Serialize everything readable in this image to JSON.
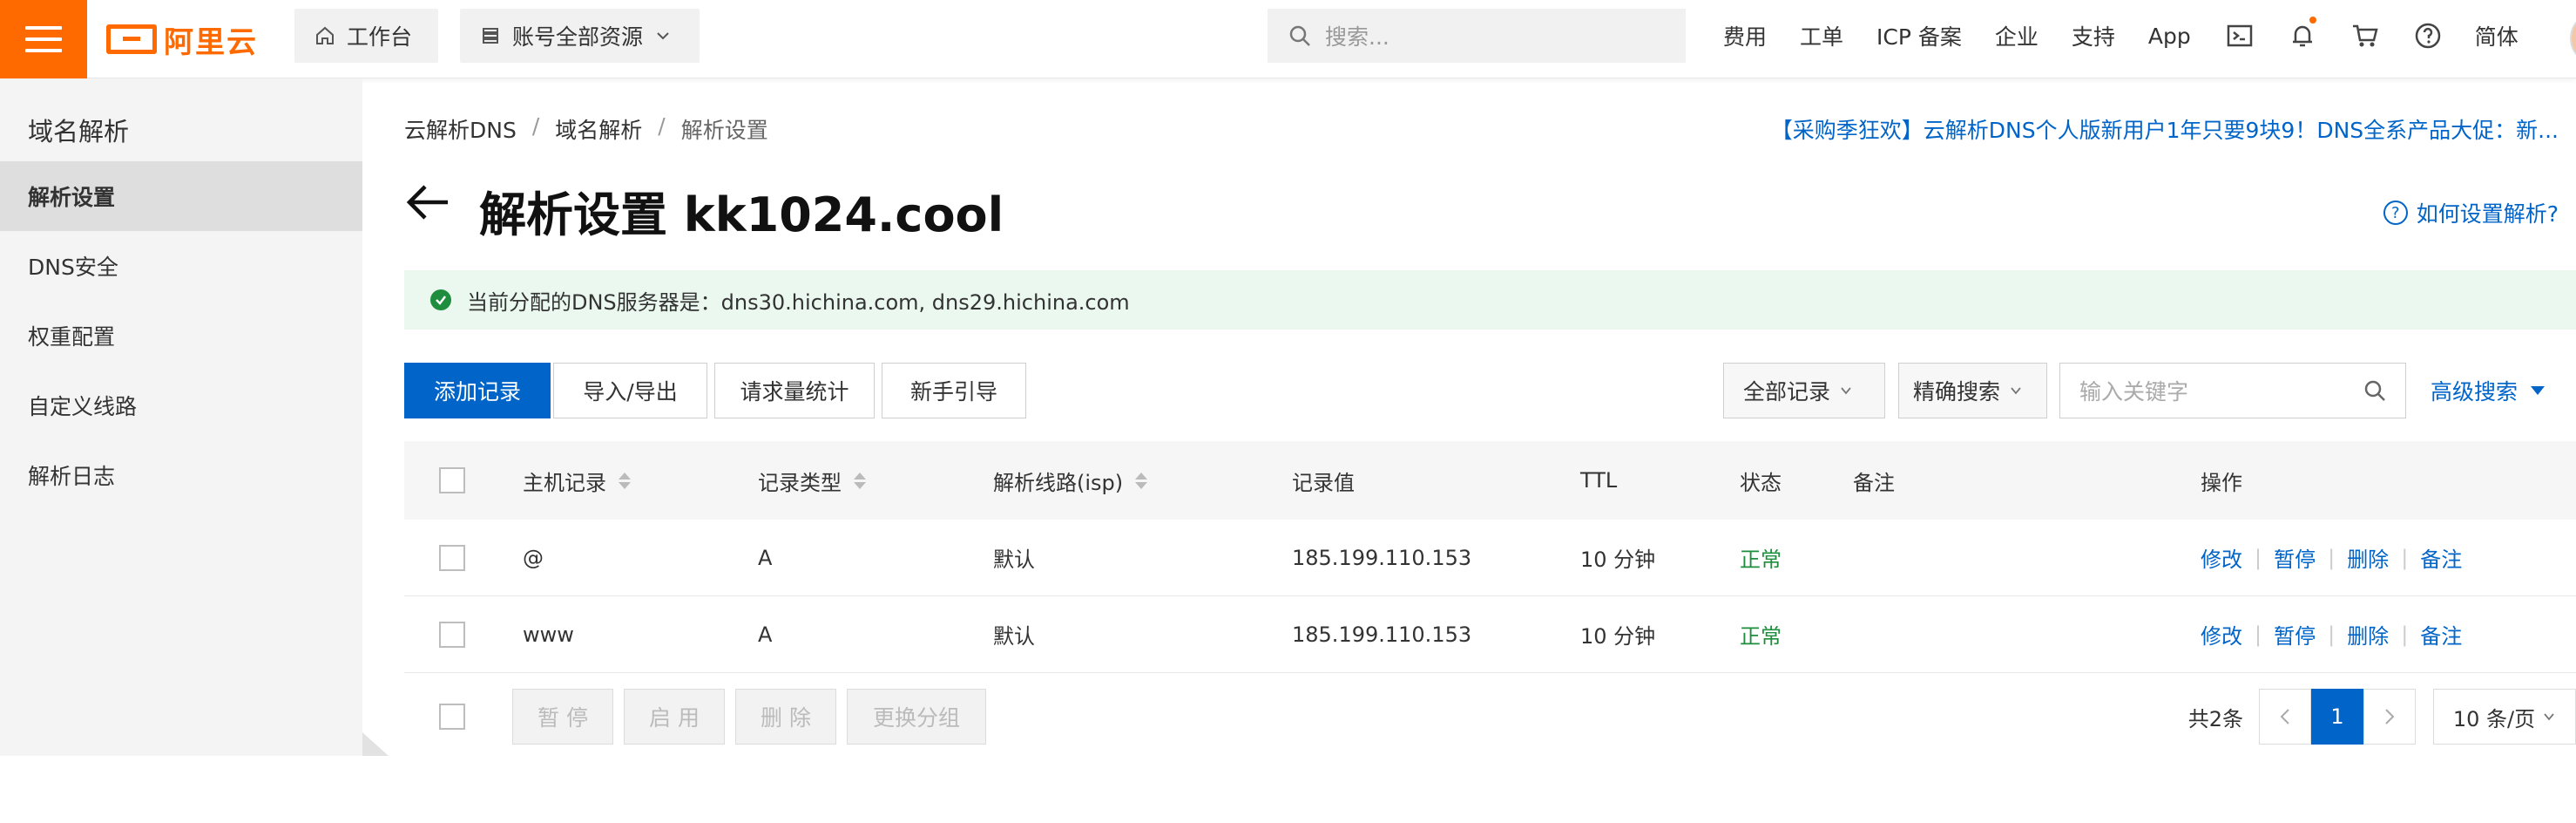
{
  "topbar": {
    "logo_text": "阿里云",
    "workbench": "工作台",
    "resources": "账号全部资源",
    "search_placeholder": "搜索...",
    "links": [
      "费用",
      "工单",
      "ICP 备案",
      "企业",
      "支持",
      "App"
    ],
    "language": "简体",
    "icons": [
      "terminal-icon",
      "bell-icon",
      "cart-icon",
      "help-icon"
    ],
    "accent": "#ff6a00"
  },
  "sidebar": {
    "title": "域名解析",
    "items": [
      {
        "label": "解析设置",
        "active": true
      },
      {
        "label": "DNS安全",
        "active": false
      },
      {
        "label": "权重配置",
        "active": false
      },
      {
        "label": "自定义线路",
        "active": false
      },
      {
        "label": "解析日志",
        "active": false
      }
    ]
  },
  "breadcrumb": [
    "云解析DNS",
    "域名解析",
    "解析设置"
  ],
  "promo": "【采购季狂欢】云解析DNS个人版新用户1年只要9块9！DNS全系产品大促：新...",
  "page_title": "解析设置 kk1024.cool",
  "help_link": "如何设置解析?",
  "notice": "当前分配的DNS服务器是：dns30.hichina.com, dns29.hichina.com",
  "toolbar": {
    "add": "添加记录",
    "import_export": "导入/导出",
    "stats": "请求量统计",
    "guide": "新手引导",
    "filter_all": "全部记录",
    "precise": "精确搜索",
    "keyword_placeholder": "输入关键字",
    "advanced": "高级搜索"
  },
  "table": {
    "headers": [
      "主机记录",
      "记录类型",
      "解析线路(isp)",
      "记录值",
      "TTL",
      "状态",
      "备注",
      "操作"
    ],
    "rows": [
      {
        "host": "@",
        "type": "A",
        "line": "默认",
        "value": "185.199.110.153",
        "ttl": "10 分钟",
        "status": "正常",
        "note": ""
      },
      {
        "host": "www",
        "type": "A",
        "line": "默认",
        "value": "185.199.110.153",
        "ttl": "10 分钟",
        "status": "正常",
        "note": ""
      }
    ],
    "actions": [
      "修改",
      "暂停",
      "删除",
      "备注"
    ]
  },
  "footer": {
    "buttons": [
      "暂 停",
      "启 用",
      "删 除",
      "更换分组"
    ],
    "total": "共2条",
    "current_page": "1",
    "page_size": "10 条/页"
  },
  "colors": {
    "primary": "#0064c8",
    "success": "#1e8e3e",
    "brand": "#ff6a00"
  }
}
